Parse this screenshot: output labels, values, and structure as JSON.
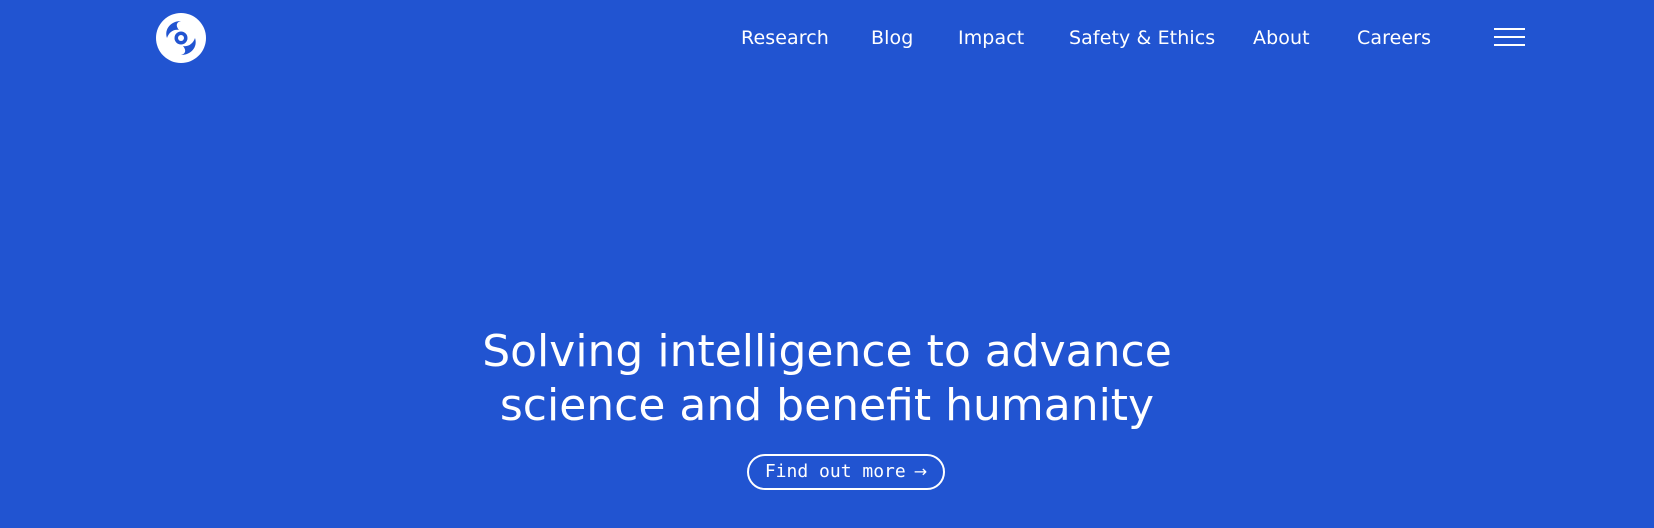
{
  "header": {
    "logo_icon": "deepmind-swirl-logo-icon",
    "nav": [
      {
        "label": "Research"
      },
      {
        "label": "Blog"
      },
      {
        "label": "Impact"
      },
      {
        "label": "Safety & Ethics"
      },
      {
        "label": "About"
      },
      {
        "label": "Careers"
      }
    ],
    "menu_icon": "hamburger-menu-icon"
  },
  "hero": {
    "title_line1": "Solving intelligence to advance",
    "title_line2": "science and benefit humanity",
    "cta_label": "Find out more",
    "cta_arrow": "→",
    "cta_icon": "arrow-right-icon"
  },
  "colors": {
    "background": "#2154D1",
    "foreground": "#FFFFFF"
  }
}
